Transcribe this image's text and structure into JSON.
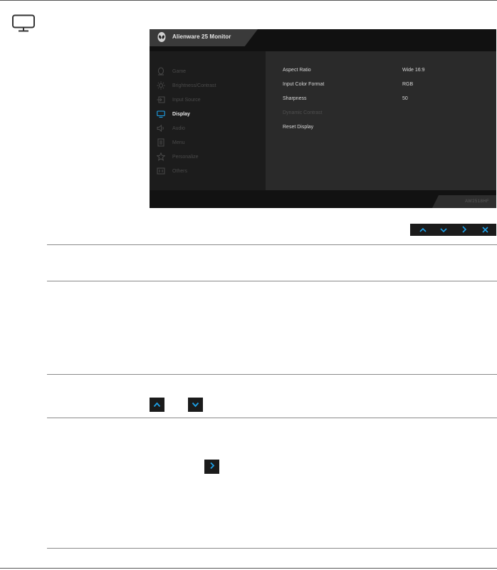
{
  "osd": {
    "title": "Alienware 25 Monitor",
    "model": "AW2518HF",
    "menu": [
      {
        "label": "Game",
        "icon": "game-icon"
      },
      {
        "label": "Brightness/Contrast",
        "icon": "brightness-icon"
      },
      {
        "label": "Input Source",
        "icon": "input-source-icon"
      },
      {
        "label": "Display",
        "icon": "display-icon"
      },
      {
        "label": "Audio",
        "icon": "audio-icon"
      },
      {
        "label": "Menu",
        "icon": "menu-icon"
      },
      {
        "label": "Personalize",
        "icon": "personalize-icon"
      },
      {
        "label": "Others",
        "icon": "others-icon"
      }
    ],
    "active_item": "Display",
    "options": [
      {
        "label": "Aspect Ratio",
        "value": "Wide 16:9"
      },
      {
        "label": "Input Color Format",
        "value": "RGB"
      },
      {
        "label": "Sharpness",
        "value": "50"
      },
      {
        "label": "Dynamic Contrast",
        "value": ""
      },
      {
        "label": "Reset Display",
        "value": ""
      }
    ],
    "disabled_option": "Dynamic Contrast"
  },
  "nav_buttons": [
    "up-arrow-icon",
    "down-arrow-icon",
    "right-arrow-icon",
    "close-icon"
  ],
  "accent_color": "#1da1e8",
  "page_icon": "monitor-icon"
}
